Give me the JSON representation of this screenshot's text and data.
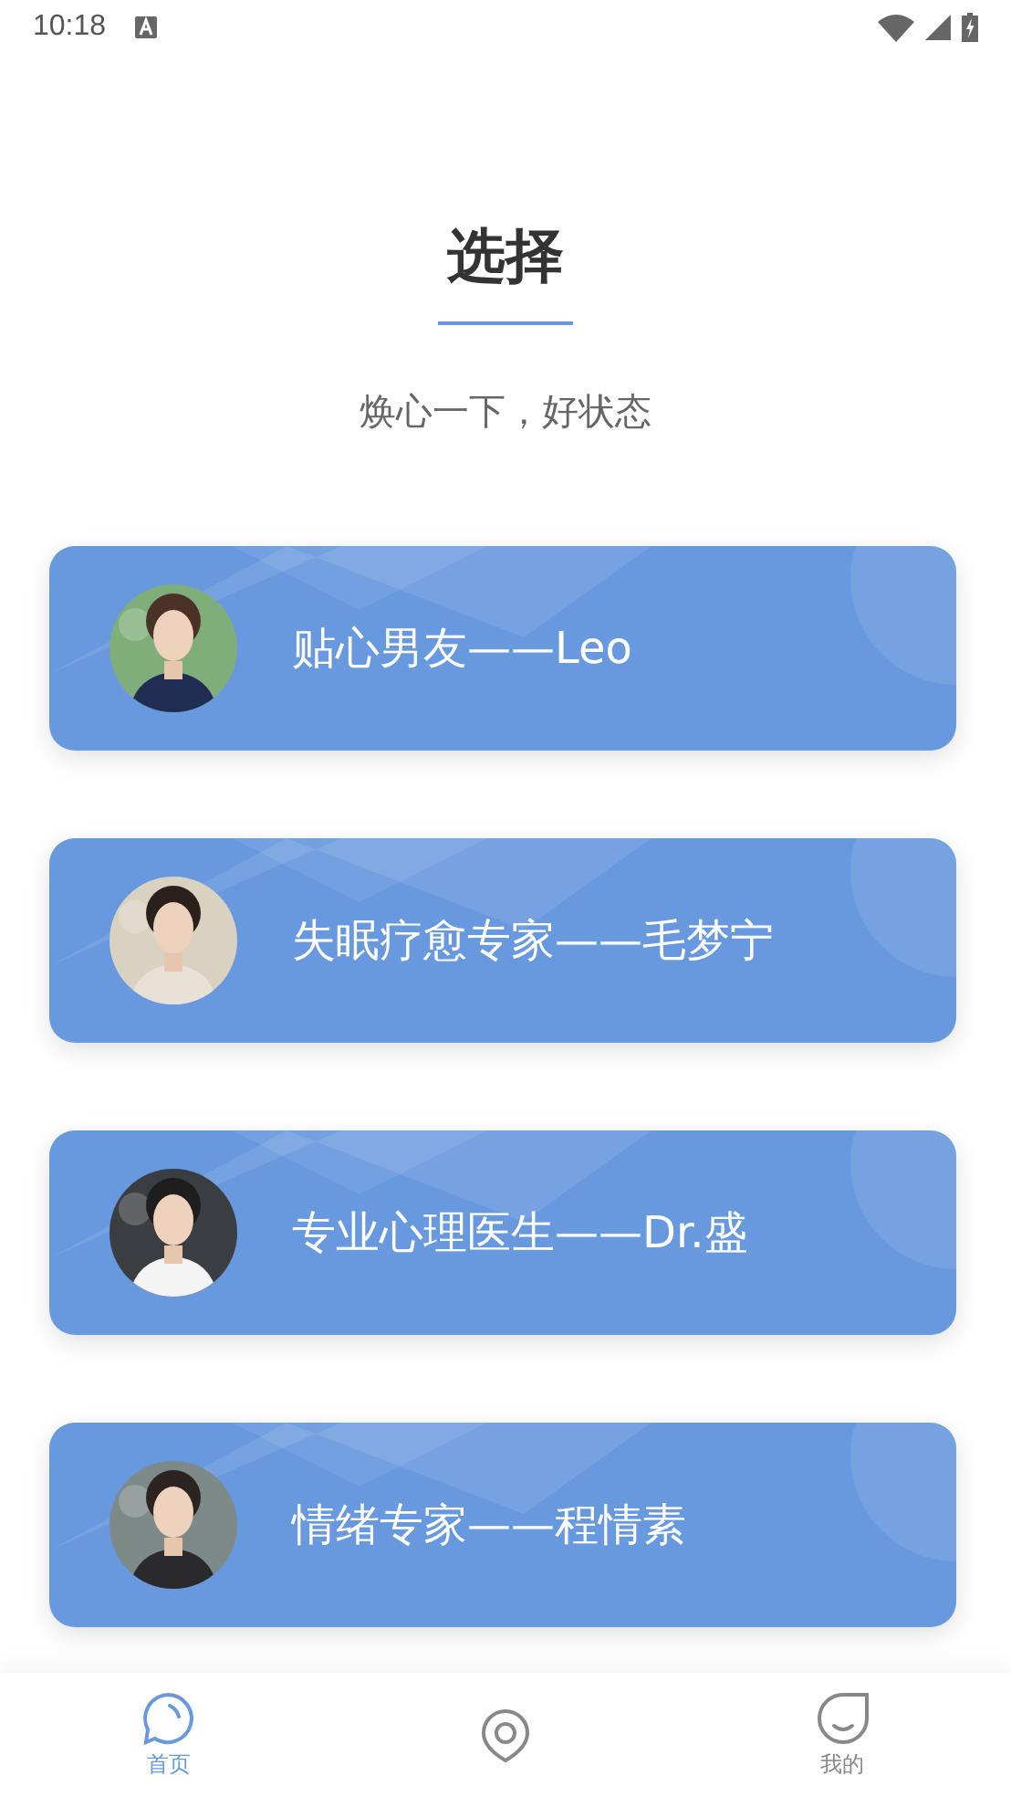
{
  "status_bar": {
    "time": "10:18"
  },
  "header": {
    "title": "选择",
    "subtitle": "焕心一下，好状态"
  },
  "cards": [
    {
      "label": "贴心男友——Leo"
    },
    {
      "label": "失眠疗愈专家——毛梦宁"
    },
    {
      "label": "专业心理医生——Dr.盛"
    },
    {
      "label": "情绪专家——程情素"
    }
  ],
  "nav": [
    {
      "kind": "chat",
      "label": "首页",
      "selected": true
    },
    {
      "kind": "pin",
      "selected": false
    },
    {
      "kind": "smile",
      "label": "我的",
      "selected": false
    }
  ]
}
